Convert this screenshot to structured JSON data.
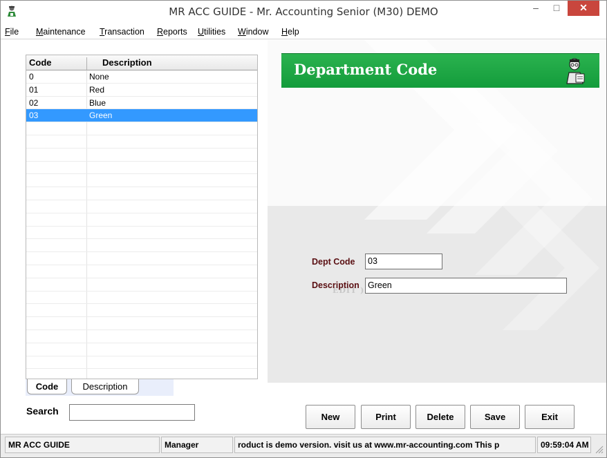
{
  "window": {
    "title": "MR ACC GUIDE - Mr. Accounting Senior (M30) DEMO",
    "min_glyph": "‒",
    "max_glyph": "□",
    "close_glyph": "✕"
  },
  "menu": [
    "File",
    "Maintenance",
    "Transaction",
    "Reports",
    "Utilities",
    "Window",
    "Help"
  ],
  "grid": {
    "columns": [
      "Code",
      "Description"
    ],
    "rows": [
      {
        "code": "0",
        "description": "None"
      },
      {
        "code": "01",
        "description": "Red"
      },
      {
        "code": "02",
        "description": "Blue"
      },
      {
        "code": "03",
        "description": "Green"
      }
    ],
    "selected_index": 3
  },
  "tabs": [
    "Code",
    "Description"
  ],
  "search": {
    "label": "Search",
    "value": ""
  },
  "form": {
    "header": "Department Code",
    "dept_code_label": "Dept Code",
    "dept_code_value": "03",
    "description_label": "Description",
    "description_value": "Green",
    "mode_ghost": "EDIT )"
  },
  "buttons": {
    "new": "New",
    "print": "Print",
    "delete": "Delete",
    "save": "Save",
    "exit": "Exit"
  },
  "status": {
    "app": "MR ACC GUIDE",
    "user": "Manager",
    "message": "roduct is demo version.  visit us at www.mr-accounting.com This p",
    "time": "09:59:04 AM"
  },
  "colors": {
    "header_green": "#1aa443",
    "selection_blue": "#3399ff",
    "close_red": "#c9463d",
    "label_maroon": "#5a0f12"
  }
}
